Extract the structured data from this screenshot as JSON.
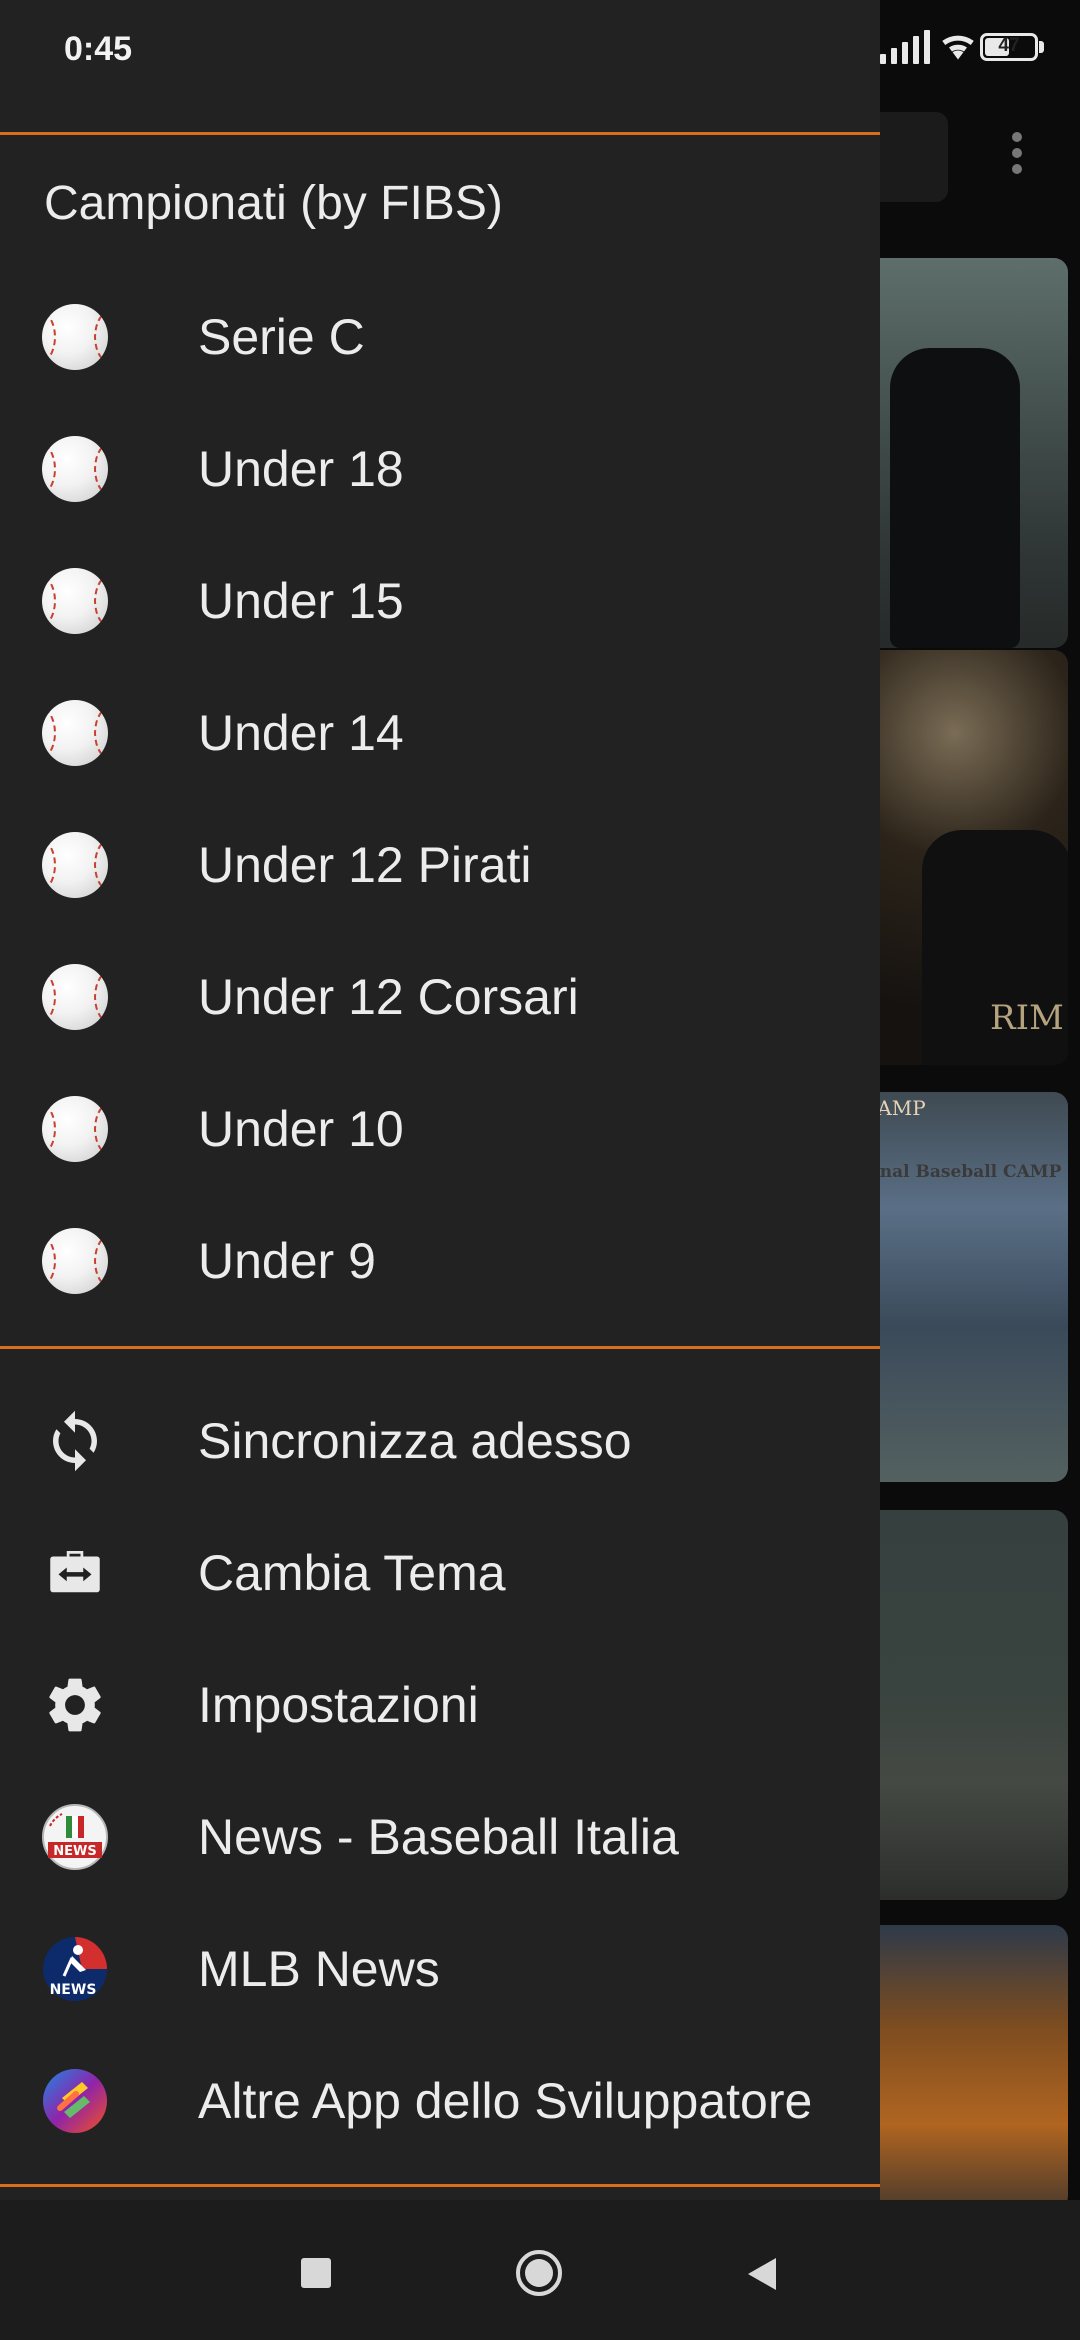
{
  "status_bar": {
    "time": "0:45",
    "battery_level": "47"
  },
  "drawer": {
    "section_title": "Campionati (by FIBS)",
    "championships": [
      {
        "label": "Serie C",
        "icon": "baseball-icon"
      },
      {
        "label": "Under 18",
        "icon": "baseball-icon"
      },
      {
        "label": "Under 15",
        "icon": "baseball-icon"
      },
      {
        "label": "Under 14",
        "icon": "baseball-icon"
      },
      {
        "label": "Under 12 Pirati",
        "icon": "baseball-icon"
      },
      {
        "label": "Under 12 Corsari",
        "icon": "baseball-icon"
      },
      {
        "label": "Under 10",
        "icon": "baseball-icon"
      },
      {
        "label": "Under 9",
        "icon": "baseball-icon"
      }
    ],
    "actions": [
      {
        "label": "Sincronizza adesso",
        "icon": "sync-icon"
      },
      {
        "label": "Cambia Tema",
        "icon": "theme-swap-icon"
      },
      {
        "label": "Impostazioni",
        "icon": "gear-icon"
      },
      {
        "label": "News - Baseball Italia",
        "icon": "news-italia-icon"
      },
      {
        "label": "MLB News",
        "icon": "mlb-news-icon"
      },
      {
        "label": "Altre App dello Sviluppatore",
        "icon": "developer-apps-icon"
      }
    ],
    "accent_color": "#d86f1d"
  },
  "background": {
    "card_texts": [
      "CAMP",
      "ional Baseball CAMP",
      "RIM"
    ]
  }
}
